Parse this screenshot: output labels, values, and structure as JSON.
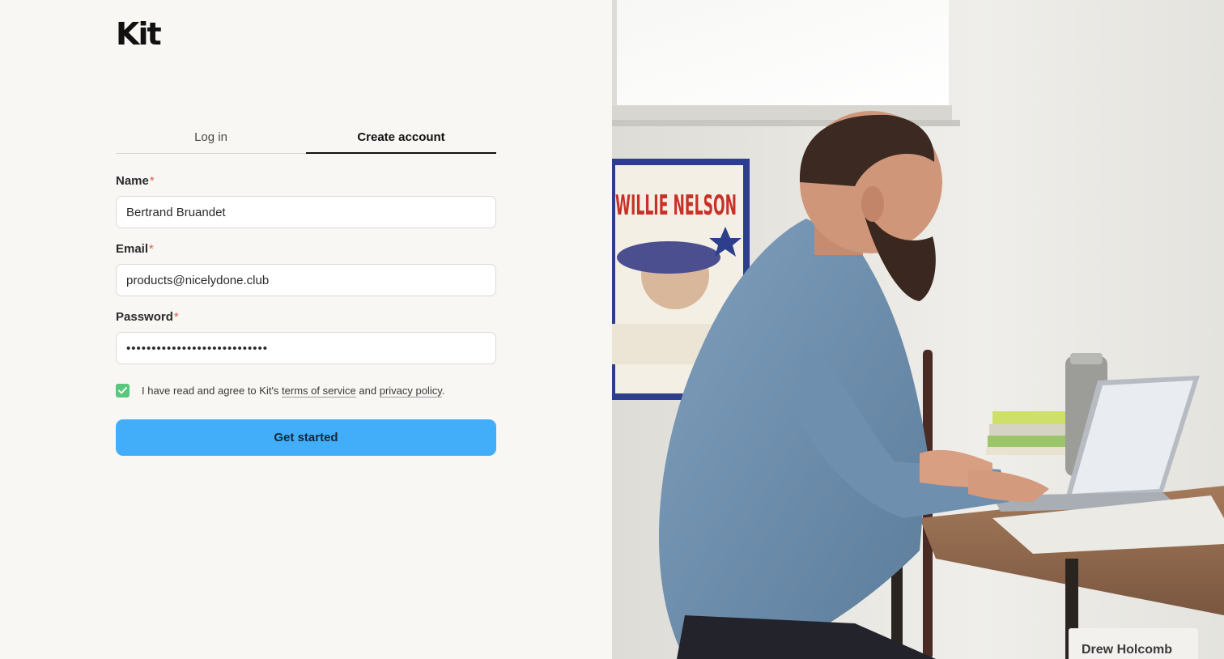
{
  "brand": {
    "logo_text": "Kit"
  },
  "tabs": [
    {
      "label": "Log in",
      "active": false
    },
    {
      "label": "Create account",
      "active": true
    }
  ],
  "form": {
    "name": {
      "label": "Name",
      "required_mark": "*",
      "value": "Bertrand Bruandet"
    },
    "email": {
      "label": "Email",
      "required_mark": "*",
      "value": "products@nicelydone.club"
    },
    "password": {
      "label": "Password",
      "required_mark": "*",
      "value": "••••••••••••••••••••••••••••"
    },
    "agree": {
      "checked": true,
      "text_prefix": "I have read and agree to Kit's ",
      "terms_link": "terms of service",
      "text_middle": " and ",
      "privacy_link": "privacy policy",
      "text_suffix": "."
    },
    "submit_label": "Get started"
  },
  "hero": {
    "caption": "Drew Holcomb",
    "poster_text": "WILLIE NELSON"
  },
  "colors": {
    "page_bg": "#f8f7f4",
    "primary_button": "#42aef9",
    "checkbox": "#5ac77e",
    "required": "#e0604a"
  }
}
